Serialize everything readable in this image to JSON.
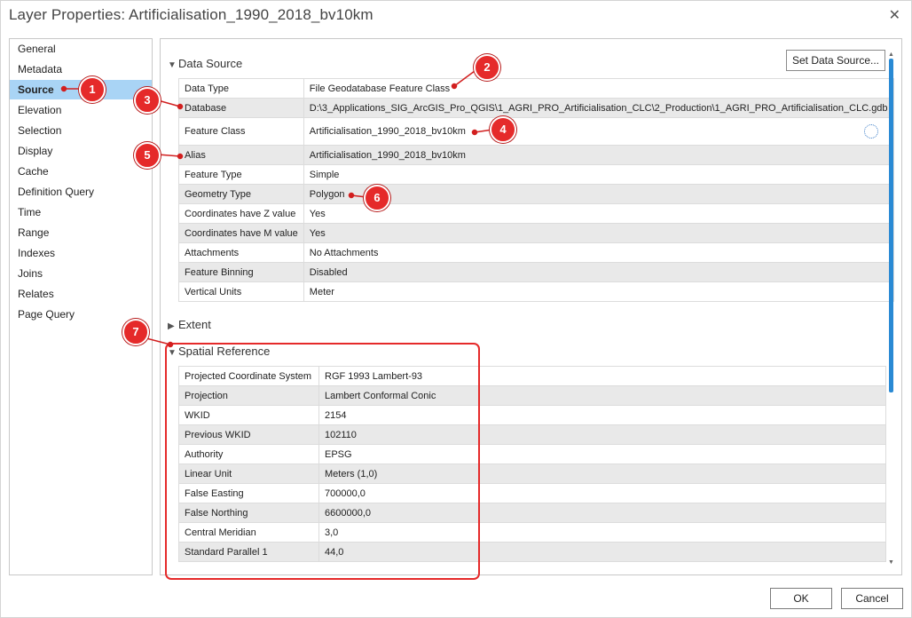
{
  "window": {
    "title": "Layer Properties: Artificialisation_1990_2018_bv10km",
    "close_glyph": "✕"
  },
  "nav": {
    "items": [
      "General",
      "Metadata",
      "Source",
      "Elevation",
      "Selection",
      "Display",
      "Cache",
      "Definition Query",
      "Time",
      "Range",
      "Indexes",
      "Joins",
      "Relates",
      "Page Query"
    ],
    "selected": "Source"
  },
  "data_source": {
    "heading": "Data Source",
    "set_button": "Set Data Source...",
    "rows": [
      {
        "key": "Data Type",
        "value": "File Geodatabase Feature Class"
      },
      {
        "key": "Database",
        "value": "D:\\3_Applications_SIG_ArcGIS_Pro_QGIS\\1_AGRI_PRO_Artificialisation_CLC\\2_Production\\1_AGRI_PRO_Artificialisation_CLC.gdb"
      },
      {
        "key": "Feature Class",
        "value": "Artificialisation_1990_2018_bv10km"
      },
      {
        "key": "Alias",
        "value": "Artificialisation_1990_2018_bv10km"
      },
      {
        "key": "Feature Type",
        "value": "Simple"
      },
      {
        "key": "Geometry Type",
        "value": "Polygon"
      },
      {
        "key": "Coordinates have Z value",
        "value": "Yes"
      },
      {
        "key": "Coordinates have M value",
        "value": "Yes"
      },
      {
        "key": "Attachments",
        "value": "No Attachments"
      },
      {
        "key": "Feature Binning",
        "value": "Disabled"
      },
      {
        "key": "Vertical Units",
        "value": "Meter"
      }
    ]
  },
  "extent": {
    "heading": "Extent"
  },
  "spatial_reference": {
    "heading": "Spatial Reference",
    "rows": [
      {
        "key": "Projected Coordinate System",
        "value": "RGF 1993 Lambert-93"
      },
      {
        "key": "Projection",
        "value": "Lambert Conformal Conic"
      },
      {
        "key": "WKID",
        "value": "2154"
      },
      {
        "key": "Previous WKID",
        "value": "102110"
      },
      {
        "key": "Authority",
        "value": "EPSG"
      },
      {
        "key": "Linear Unit",
        "value": "Meters (1,0)"
      },
      {
        "key": "False Easting",
        "value": "700000,0"
      },
      {
        "key": "False Northing",
        "value": "6600000,0"
      },
      {
        "key": "Central Meridian",
        "value": "3,0"
      },
      {
        "key": "Standard Parallel 1",
        "value": "44,0"
      }
    ]
  },
  "footer": {
    "ok": "OK",
    "cancel": "Cancel"
  },
  "callouts": [
    "1",
    "2",
    "3",
    "4",
    "5",
    "6",
    "7"
  ],
  "colors": {
    "accent": "#2a8ad4",
    "selection": "#a9d4f5",
    "callout": "#e52a2a"
  },
  "icons": {
    "expand": "chevron-down-icon",
    "collapse": "chevron-right-icon",
    "feature_class": "database-icon"
  }
}
